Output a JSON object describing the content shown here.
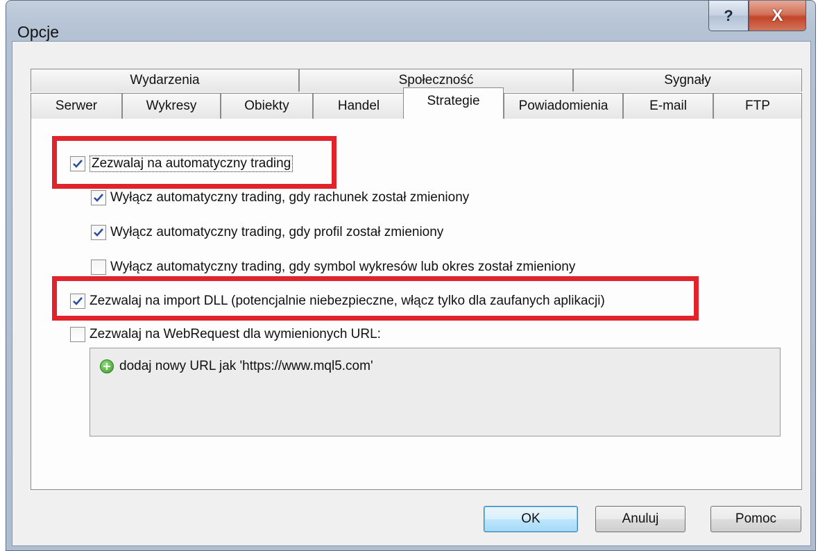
{
  "window": {
    "title": "Opcje",
    "help_label": "?",
    "close_label": "X"
  },
  "tabs_top": [
    {
      "label": "Wydarzenia"
    },
    {
      "label": "Społeczność"
    },
    {
      "label": "Sygnały"
    }
  ],
  "tabs_bottom": [
    {
      "label": "Serwer"
    },
    {
      "label": "Wykresy"
    },
    {
      "label": "Obiekty"
    },
    {
      "label": "Handel"
    },
    {
      "label": "Strategie",
      "active": true
    },
    {
      "label": "Powiadomienia"
    },
    {
      "label": "E-mail"
    },
    {
      "label": "FTP"
    }
  ],
  "options": {
    "allow_auto_trading": {
      "label": "Zezwalaj na automatyczny trading",
      "checked": true
    },
    "disable_on_account_change": {
      "label": "Wyłącz automatyczny trading, gdy rachunek został zmieniony",
      "checked": true
    },
    "disable_on_profile_change": {
      "label": "Wyłącz automatyczny trading, gdy profil został zmieniony",
      "checked": true
    },
    "disable_on_symbol_change": {
      "label": "Wyłącz automatyczny trading, gdy symbol wykresów lub okres został zmieniony",
      "checked": false
    },
    "allow_dll_import": {
      "label": "Zezwalaj na import DLL (potencjalnie niebezpieczne, włącz tylko dla zaufanych aplikacji)",
      "checked": true
    },
    "allow_webrequest": {
      "label": "Zezwalaj na WebRequest dla wymienionych URL:",
      "checked": false
    }
  },
  "url_list": {
    "add_item_label": "dodaj nowy URL jak 'https://www.mql5.com'",
    "add_icon": "plus-circle-icon"
  },
  "buttons": {
    "ok": "OK",
    "cancel": "Anuluj",
    "help": "Pomoc"
  },
  "colors": {
    "highlight": "#e1232b",
    "checkmark": "#2b4f9c"
  }
}
